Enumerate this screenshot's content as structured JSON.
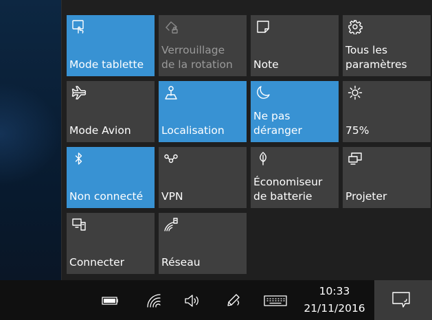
{
  "action_center": {
    "tiles": [
      {
        "label": "Mode tablette",
        "icon": "tablet-mode-icon",
        "state": "active"
      },
      {
        "label": "Verrouillage\nde la rotation",
        "icon": "rotation-lock-icon",
        "state": "disabled"
      },
      {
        "label": "Note",
        "icon": "note-icon",
        "state": "off"
      },
      {
        "label": "Tous les\nparamètres",
        "icon": "settings-gear-icon",
        "state": "off"
      },
      {
        "label": "Mode Avion",
        "icon": "airplane-icon",
        "state": "off"
      },
      {
        "label": "Localisation",
        "icon": "location-icon",
        "state": "active"
      },
      {
        "label": "Ne pas\ndéranger",
        "icon": "moon-icon",
        "state": "active"
      },
      {
        "label": "75%",
        "icon": "brightness-icon",
        "state": "off"
      },
      {
        "label": "Non connecté",
        "icon": "bluetooth-icon",
        "state": "active"
      },
      {
        "label": "VPN",
        "icon": "vpn-icon",
        "state": "off"
      },
      {
        "label": "Économiseur\nde batterie",
        "icon": "battery-saver-leaf-icon",
        "state": "off"
      },
      {
        "label": "Projeter",
        "icon": "project-icon",
        "state": "off"
      },
      {
        "label": "Connecter",
        "icon": "connect-icon",
        "state": "off"
      },
      {
        "label": "Réseau",
        "icon": "network-icon",
        "state": "off"
      }
    ]
  },
  "taskbar": {
    "tray_icons": [
      "battery-icon",
      "wifi-icon",
      "volume-icon",
      "pen-icon",
      "keyboard-icon"
    ],
    "time": "10:33",
    "date": "21/11/2016",
    "action_center_icon": "action-center-icon"
  },
  "colors": {
    "tile_active": "#3892d3",
    "tile_inactive": "#3f3f3f",
    "panel_bg": "#1f1f1f",
    "taskbar_bg": "#101010"
  }
}
